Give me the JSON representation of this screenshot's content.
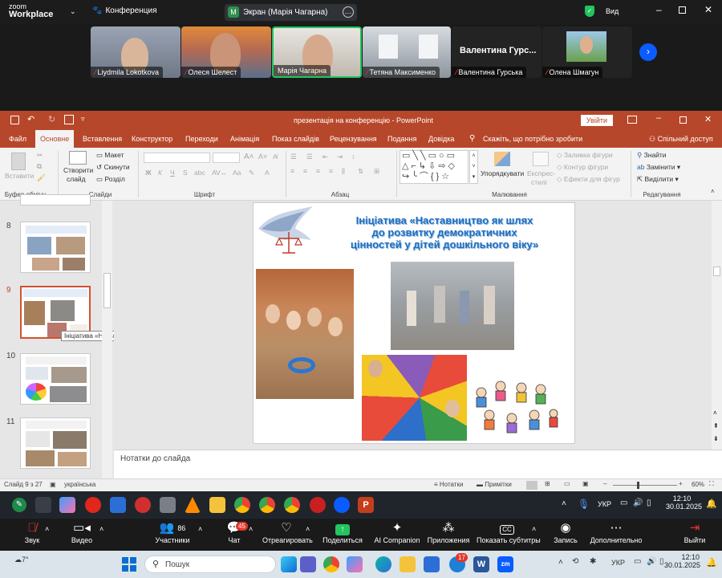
{
  "zoom_top": {
    "brand_line1": "zoom",
    "brand_line2": "Workplace",
    "meeting_label": "Конференция",
    "screen_share_label": "Экран (Марія Чагарна)",
    "view_label": "Вид"
  },
  "gallery": {
    "participants": [
      {
        "name": "Liydmila Lokotkova"
      },
      {
        "name": "Олеся Шелест"
      },
      {
        "name": "Марія Чагарна"
      },
      {
        "name": "Тетяна Максименко"
      },
      {
        "name": "Валентина Гурська",
        "display_name": "Валентина  Гурс..."
      },
      {
        "name": "Олена Шмагун"
      }
    ]
  },
  "ppt": {
    "title": "презентація на конференцію  -  PowerPoint",
    "signin_button": "Увійти",
    "tabs": [
      "Файл",
      "Основне",
      "Вставлення",
      "Конструктор",
      "Переходи",
      "Анімація",
      "Показ слайдів",
      "Рецензування",
      "Подання",
      "Довідка"
    ],
    "tell_me": "Скажіть, що потрібно зробити",
    "share": "Спільний доступ",
    "ribbon": {
      "paste": "Вставити",
      "clipboard_group": "Буфер обміну",
      "new_slide_1": "Створити",
      "new_slide_2": "слайд",
      "layout": "Макет",
      "reset": "Скинути",
      "section": "Розділ",
      "slides_group": "Слайди",
      "font_group": "Шрифт",
      "bold": "Ж",
      "italic": "К",
      "underline": "Ч",
      "strike": "S",
      "shadow": "abc",
      "paragraph_group": "Абзац",
      "arrange": "Упорядкувати",
      "quick_styles_1": "Експрес-",
      "quick_styles_2": "стилі",
      "shape_fill": "Заливка фігури",
      "shape_outline": "Контур фігури",
      "shape_effects": "Ефекти для фігур",
      "drawing_group": "Малювання",
      "find": "Знайти",
      "replace": "Замінити",
      "select": "Виділити",
      "editing_group": "Редагування"
    },
    "thumbnails": [
      {
        "num": "8"
      },
      {
        "num": "9"
      },
      {
        "num": "10"
      },
      {
        "num": "11"
      }
    ],
    "thumb_tooltip": "Ініціатива «Наставництво як шлях...",
    "slide": {
      "title_line1": "Ініціатива «Наставництво як шлях",
      "title_line2": "до розвитку демократичних",
      "title_line3": "цінностей у дітей дошкільного віку»"
    },
    "notes_placeholder": "Нотатки до слайда",
    "status": {
      "slide_info": "Слайд 9 з 27",
      "language": "українська",
      "notes": "Нотатки",
      "comments": "Примітки",
      "zoom": "60%"
    }
  },
  "taskbar1": {
    "lang": "УКР",
    "time": "12:10",
    "date": "30.01.2025"
  },
  "zoom_controls": {
    "audio": "Звук",
    "video": "Видео",
    "participants": "Участники",
    "participants_count": "86",
    "chat": "Чат",
    "chat_badge": "45",
    "react": "Отреагировать",
    "share": "Поделиться",
    "ai": "AI Companion",
    "apps": "Приложения",
    "captions": "Показать субтитры",
    "record": "Запись",
    "more": "Дополнительно",
    "leave": "Выйти"
  },
  "taskbar2": {
    "weather": "7°",
    "search": "Пошук",
    "badge": "17",
    "lang": "УКР",
    "time": "12:10",
    "date": "30.01.2025"
  },
  "colors": {
    "ppt_accent": "#b7472a",
    "zoom_blue": "#0b5cff",
    "active_green": "#22c55e",
    "mic_red": "#e5352b"
  }
}
